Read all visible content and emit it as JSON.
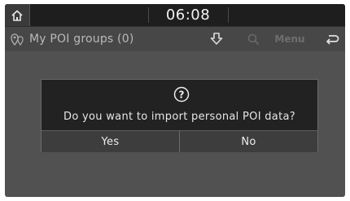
{
  "status_bar": {
    "time": "06:08",
    "home_icon": "home-icon"
  },
  "header": {
    "group_icon": "poi-group-icon",
    "title": "My POI groups (0)",
    "import_icon": "import-download-icon",
    "search_icon": "search-icon",
    "menu_label": "Menu",
    "back_icon": "back-icon"
  },
  "dialog": {
    "icon": "question-circle-icon",
    "icon_glyph": "?",
    "message": "Do you want to import personal POI data?",
    "yes_label": "Yes",
    "no_label": "No"
  },
  "colors": {
    "background": "#515151",
    "status_bar": "#1e1e1e",
    "dialog": "#222222"
  }
}
